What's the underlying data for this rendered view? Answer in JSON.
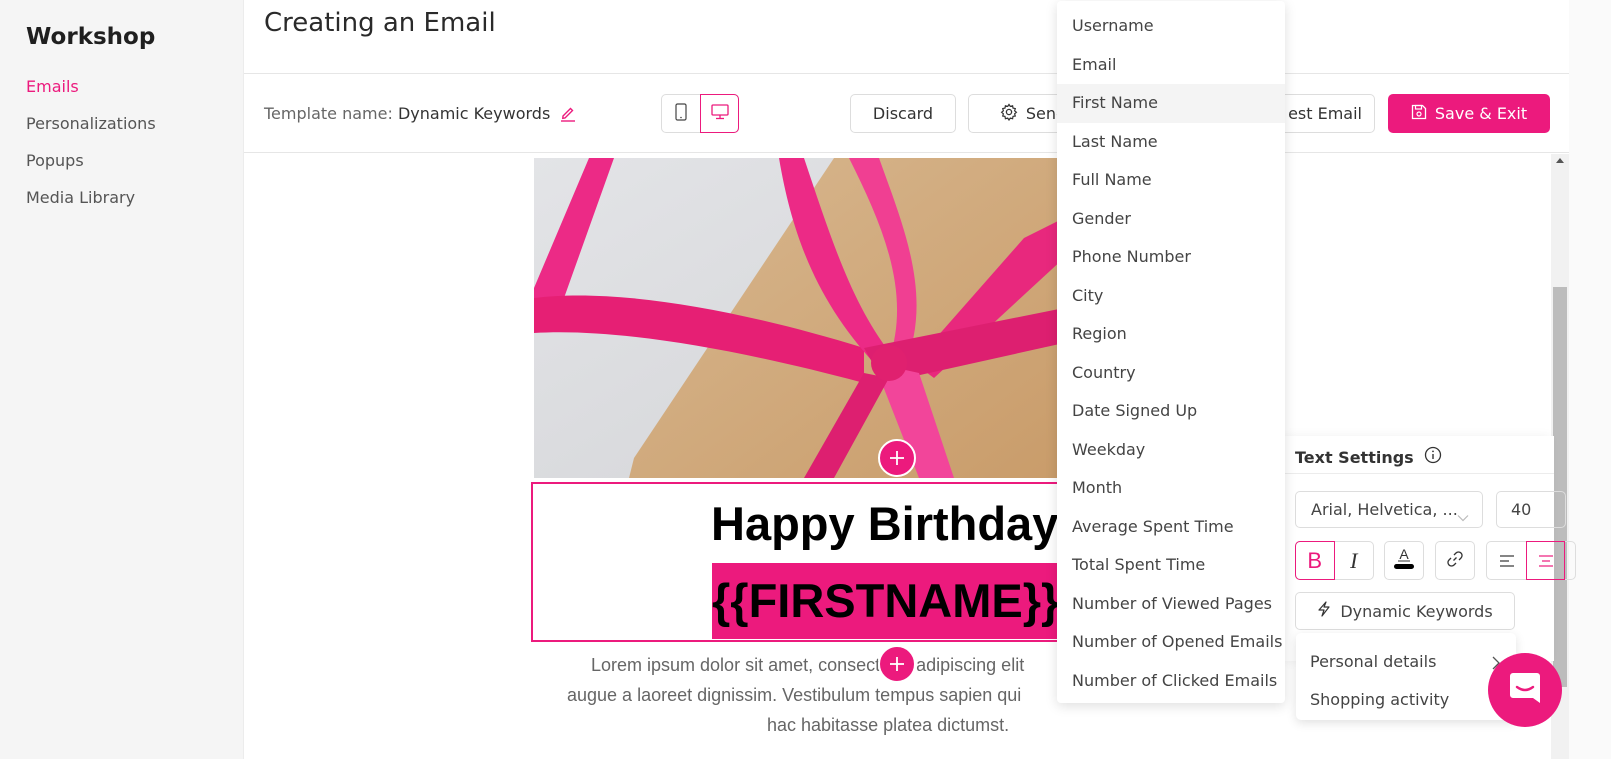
{
  "sidebar": {
    "brand": "Workshop",
    "items": [
      {
        "label": "Emails",
        "active": true
      },
      {
        "label": "Personalizations",
        "active": false
      },
      {
        "label": "Popups",
        "active": false
      },
      {
        "label": "Media Library",
        "active": false
      }
    ]
  },
  "header": {
    "title": "Creating an Email"
  },
  "toolbar": {
    "template_label": "Template name:",
    "template_name": "Dynamic Keywords",
    "device_options": [
      "mobile",
      "desktop"
    ],
    "device_selected": "desktop",
    "discard_label": "Discard",
    "send_label": "Send",
    "test_email_label": "est Email",
    "save_label": "Save & Exit"
  },
  "email": {
    "heading_line1": "Happy Birthday",
    "heading_line2": "{{FIRSTNAME}}",
    "body_lines": [
      "Lorem ipsum dolor sit amet, consectetur adipiscing elit",
      "augue a laoreet dignissim. Vestibulum tempus sapien qui",
      "hac habitasse platea dictumst."
    ]
  },
  "text_settings": {
    "title": "Text Settings",
    "font_family": "Arial, Helvetica, ...",
    "font_size": "40",
    "bold_active": true,
    "align_selected": "center",
    "dynamic_keywords_label": "Dynamic Keywords"
  },
  "keyword_categories": [
    {
      "label": "Personal details",
      "has_submenu": true
    },
    {
      "label": "Shopping activity",
      "has_submenu": false
    }
  ],
  "keyword_options": {
    "highlighted": "First Name",
    "items": [
      "Username",
      "Email",
      "First Name",
      "Last Name",
      "Full Name",
      "Gender",
      "Phone Number",
      "City",
      "Region",
      "Country",
      "Date Signed Up",
      "Weekday",
      "Month",
      "Average Spent Time",
      "Total Spent Time",
      "Number of Viewed Pages",
      "Number of Opened Emails",
      "Number of Clicked Emails"
    ]
  },
  "colors": {
    "accent": "#ec1a7d",
    "text_color_swatch": "#000000"
  }
}
